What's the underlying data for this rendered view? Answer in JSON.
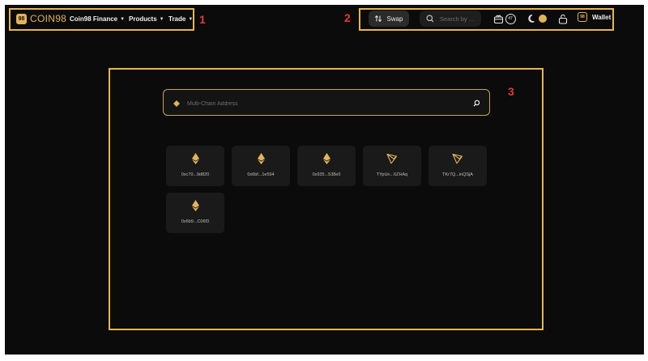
{
  "header": {
    "brand_text": "COIN98",
    "brand_logo_text": "98",
    "nav": [
      {
        "label": "Coin98 Finance"
      },
      {
        "label": "Products"
      },
      {
        "label": "Trade"
      }
    ],
    "swap_label": "Swap",
    "search_placeholder": "Search by ...",
    "notification_count": "47",
    "wallet_logo_text": "98",
    "wallet_label": "Wallet"
  },
  "annotations": [
    "1",
    "2",
    "3"
  ],
  "main": {
    "address_placeholder": "Multi-Chain Address",
    "wallets": [
      {
        "chain_icon": "ethereum-icon",
        "address": "0xc70...9d820"
      },
      {
        "chain_icon": "ethereum-icon",
        "address": "0x6bf...1e594"
      },
      {
        "chain_icon": "ethereum-icon",
        "address": "0x935...538e0"
      },
      {
        "chain_icon": "tron-icon",
        "address": "TYpUn...6ZHAq"
      },
      {
        "chain_icon": "tron-icon",
        "address": "TKr7Q...inQSjA"
      },
      {
        "chain_icon": "ethereum-icon",
        "address": "0x6b9...C06f3"
      }
    ]
  },
  "colors": {
    "accent": "#e2b45a",
    "background": "#0b0b0b",
    "highlight_box": "#e7b64c",
    "annotation": "#e53935"
  }
}
